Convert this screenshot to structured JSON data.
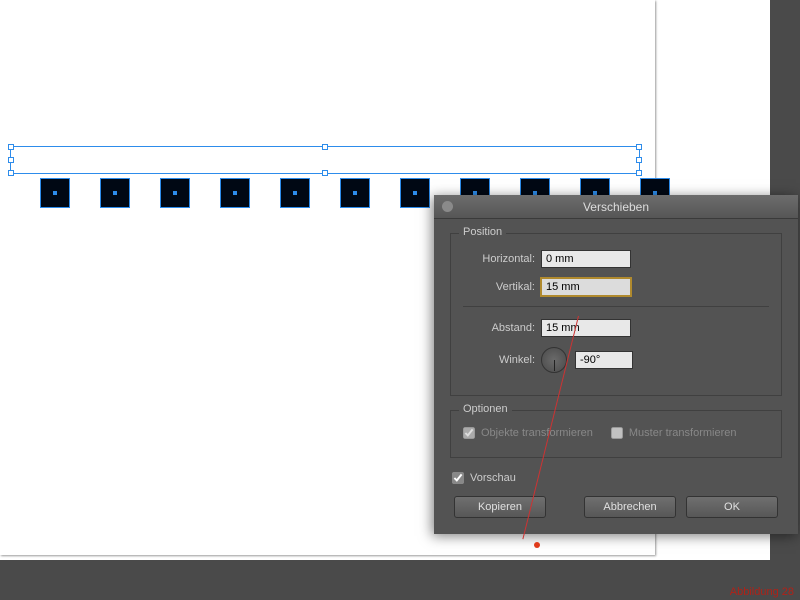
{
  "dialog": {
    "title": "Verschieben",
    "position_group": "Position",
    "horizontal_label": "Horizontal:",
    "horizontal_value": "0 mm",
    "vertikal_label": "Vertikal:",
    "vertikal_value": "15 mm",
    "abstand_label": "Abstand:",
    "abstand_value": "15 mm",
    "winkel_label": "Winkel:",
    "winkel_value": "-90°",
    "optionen_group": "Optionen",
    "objekte_label": "Objekte transformieren",
    "muster_label": "Muster transformieren",
    "vorschau_label": "Vorschau",
    "kopieren_label": "Kopieren",
    "abbrechen_label": "Abbrechen",
    "ok_label": "OK"
  },
  "canvas": {
    "squares_count": 11
  },
  "watermark": "Abbildung 28"
}
